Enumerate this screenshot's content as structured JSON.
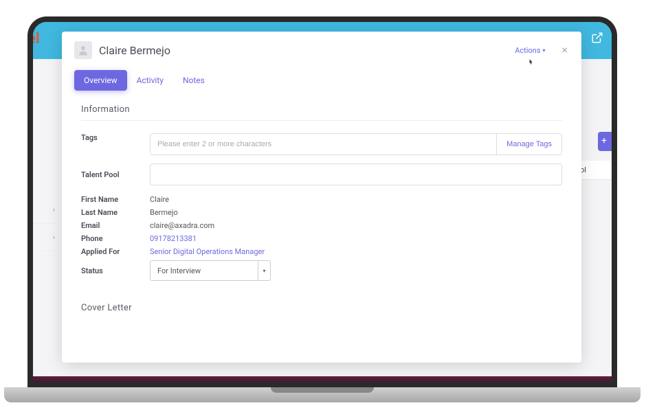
{
  "background": {
    "logo_fragment": "el",
    "talent_pool_header": "Talent Pool"
  },
  "modal": {
    "title": "Claire Bermejo",
    "actions_label": "Actions",
    "tabs": {
      "overview": "Overview",
      "activity": "Activity",
      "notes": "Notes"
    },
    "information": {
      "section_title": "Information",
      "tags_label": "Tags",
      "tags_placeholder": "Please enter 2 or more characters",
      "manage_tags_label": "Manage Tags",
      "talent_pool_label": "Talent Pool",
      "fields": {
        "first_name_label": "First Name",
        "first_name_value": "Claire",
        "last_name_label": "Last Name",
        "last_name_value": "Bermejo",
        "email_label": "Email",
        "email_value": "claire@axadra.com",
        "phone_label": "Phone",
        "phone_value": "09178213381",
        "applied_for_label": "Applied For",
        "applied_for_value": "Senior Digital Operations Manager",
        "status_label": "Status",
        "status_value": "For Interview"
      }
    },
    "cover_letter": {
      "section_title": "Cover Letter"
    }
  }
}
